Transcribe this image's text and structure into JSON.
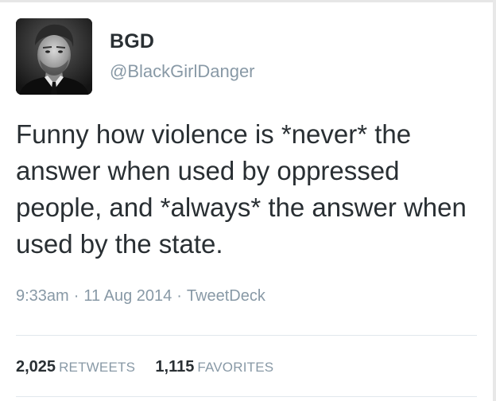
{
  "author": {
    "name": "BGD",
    "handle": "@BlackGirlDanger"
  },
  "tweet": {
    "text": "Funny how violence is *never* the answer when used by oppressed people, and *always* the answer when used by the state.",
    "time": "9:33am",
    "date": "11 Aug 2014",
    "client": "TweetDeck",
    "separator": "·"
  },
  "stats": {
    "retweets_count": "2,025",
    "retweets_label": "RETWEETS",
    "favorites_count": "1,115",
    "favorites_label": "FAVORITES"
  },
  "colors": {
    "text": "#292f33",
    "secondary": "#8899a6",
    "divider": "#e1e8ed"
  }
}
